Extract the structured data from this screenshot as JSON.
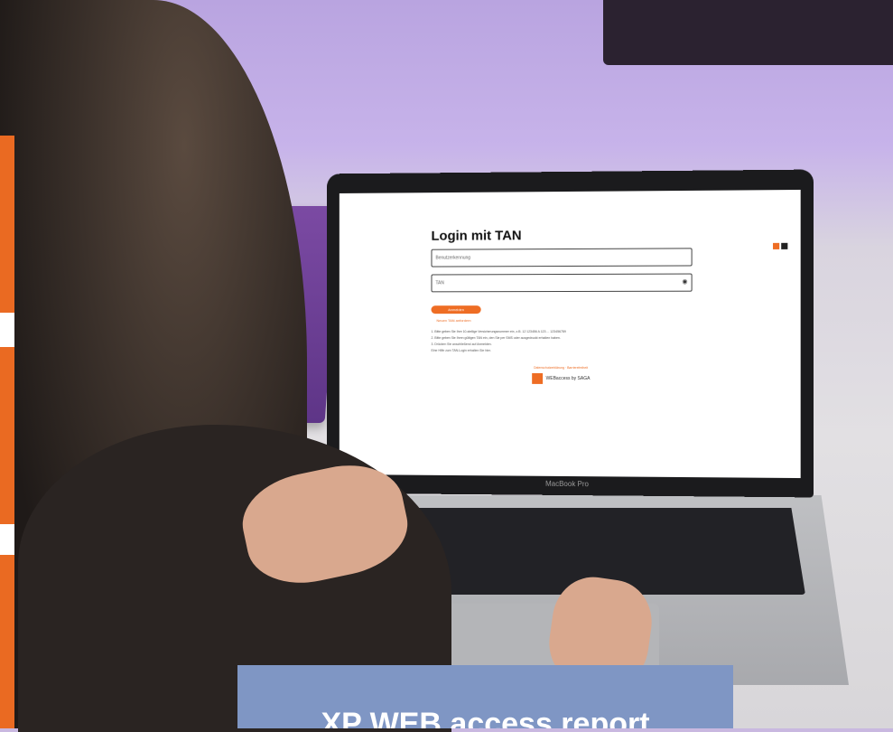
{
  "photo": {
    "laptop_brand": "MacBook Pro"
  },
  "screen": {
    "title": "Login mit TAN",
    "username_placeholder": "Benutzerkennung",
    "tan_placeholder": "TAN",
    "login_button": "Anmelden",
    "forgot_link": "Neuen TAN anfordern",
    "instructions": [
      "1. Bitte geben Sie Ihre 10-stellige Versicherungsnummer ein, z.B. 12 123456 A 123 ... 123456789",
      "2. Bitte geben Sie Ihren gültigen TAN ein, den Sie per SMS oder ausgedruckt erhalten haben.",
      "3. Drücken Sie anschließend auf Anmelden."
    ],
    "help_line": "Eine Hilfe zum TAN-Login erhalten Sie hier.",
    "footer_link": "Datenschutzerklärung · Barrierefreiheit",
    "logo_text": "WEBaccess by SAGA"
  },
  "caption": {
    "text": "XP WEB access report"
  },
  "colors": {
    "accent_orange": "#ea6a22",
    "caption_blue": "#7f96c4"
  }
}
